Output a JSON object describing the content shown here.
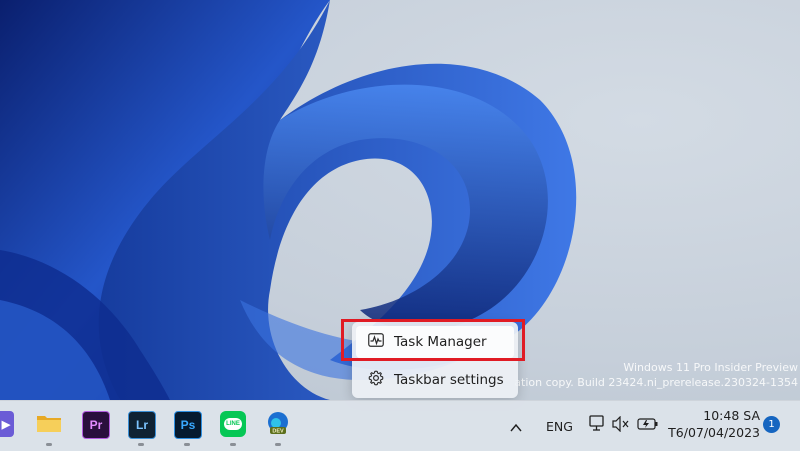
{
  "watermark": {
    "line1": "Windows 11 Pro Insider Preview",
    "line2": "ation copy. Build 23424.ni_prerelease.230324-1354"
  },
  "context_menu": {
    "items": [
      {
        "label": "Task Manager",
        "icon": "activity-monitor-icon"
      },
      {
        "label": "Taskbar settings",
        "icon": "gear-icon"
      }
    ]
  },
  "taskbar": {
    "apps": [
      {
        "name": "video-call",
        "icon": "video-camera-icon",
        "color": "#6b5cd6"
      },
      {
        "name": "file-explorer",
        "icon": "folder-icon",
        "color": "#f2c14e"
      },
      {
        "name": "premiere",
        "label": "Pr",
        "color": "#2a0f3d",
        "text_color": "#e38cff"
      },
      {
        "name": "lightroom",
        "label": "Lr",
        "color": "#0f2233",
        "text_color": "#7cc4ff"
      },
      {
        "name": "photoshop",
        "label": "Ps",
        "color": "#061a2e",
        "text_color": "#39a9ff"
      },
      {
        "name": "line",
        "label": "LINE",
        "color": "#06c755",
        "text_color": "#ffffff"
      },
      {
        "name": "edge-dev",
        "label": "DEV",
        "color": "#1b6fd1"
      }
    ],
    "tray": {
      "overflow_icon": "chevron-up-icon",
      "language": "ENG",
      "network_icon": "network-icon",
      "volume_icon": "volume-muted-icon",
      "battery_icon": "battery-icon"
    },
    "clock": {
      "time": "10:48 SA",
      "date": "T6/07/04/2023"
    },
    "notification_count": "1"
  },
  "colors": {
    "highlight": "#e01b24",
    "wallpaper_bloom": "#1f47b8"
  }
}
